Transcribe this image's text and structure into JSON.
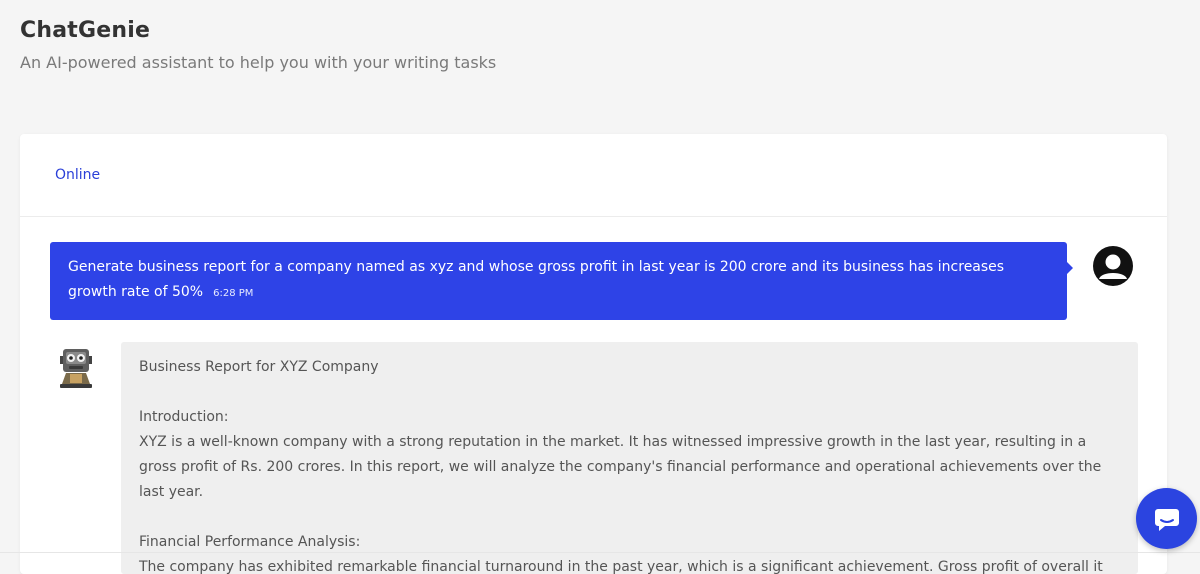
{
  "app": {
    "title": "ChatGenie",
    "subtitle": "An AI-powered assistant to help you with your writing tasks"
  },
  "chat": {
    "status": "Online",
    "messages": [
      {
        "role": "user",
        "text": "Generate business report for a company named as xyz and whose gross profit in last year is 200 crore and its business has increases growth rate of 50%",
        "time": "6:28 PM"
      },
      {
        "role": "assistant",
        "paragraphs": [
          "Business Report for XYZ Company",
          "Introduction:\nXYZ is a well-known company with a strong reputation in the market. It has witnessed impressive growth in the last year, resulting in a gross profit of Rs. 200 crores. In this report, we will analyze the company's financial performance and operational achievements over the last year.",
          "Financial Performance Analysis:\nThe company has exhibited remarkable financial turnaround in the past year, which is a significant achievement. Gross profit of overall it"
        ]
      }
    ]
  },
  "colors": {
    "accent": "#2e43e7",
    "status": "#2a3fd8",
    "page_bg": "#f5f5f5",
    "bot_bubble": "#efefef"
  },
  "icons": {
    "user_avatar": "user-avatar-icon",
    "bot_avatar": "robot-icon",
    "chat_launcher": "chat-bubble-icon"
  }
}
